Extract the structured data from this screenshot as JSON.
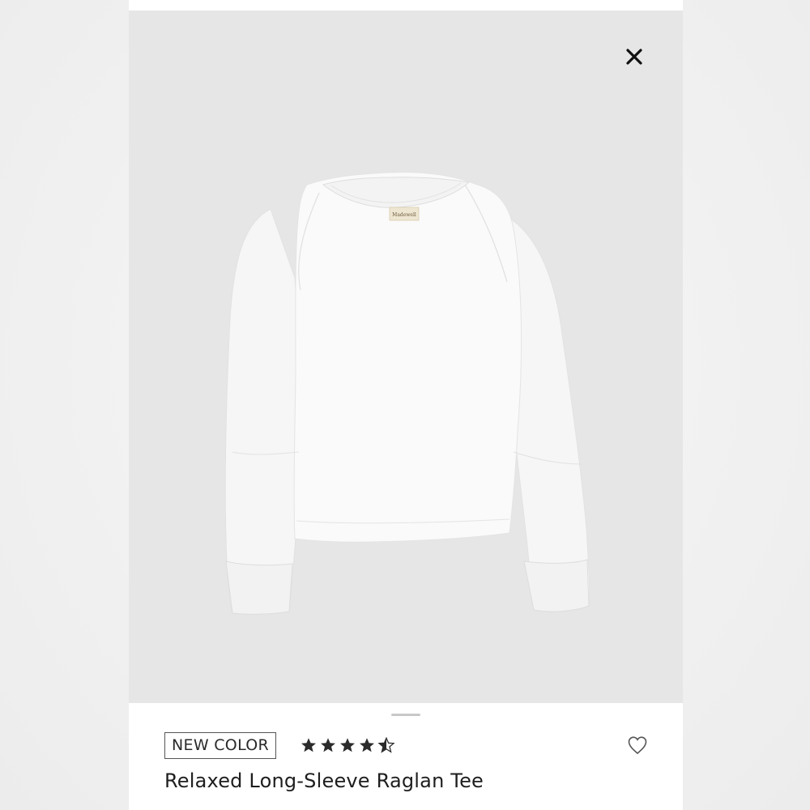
{
  "product": {
    "badge": "NEW COLOR",
    "title": "Relaxed Long-Sleeve Raglan Tee",
    "rating": 4.5,
    "rating_max": 5,
    "photo_label_text": "Madewell"
  },
  "icons": {
    "close": "close-icon",
    "star": "star-icon",
    "heart": "heart-icon"
  },
  "colors": {
    "photo_background": "#e6e6e6",
    "shirt": "#f8f8f8",
    "star": "#2b2b2b",
    "text": "#1e1e1e"
  }
}
